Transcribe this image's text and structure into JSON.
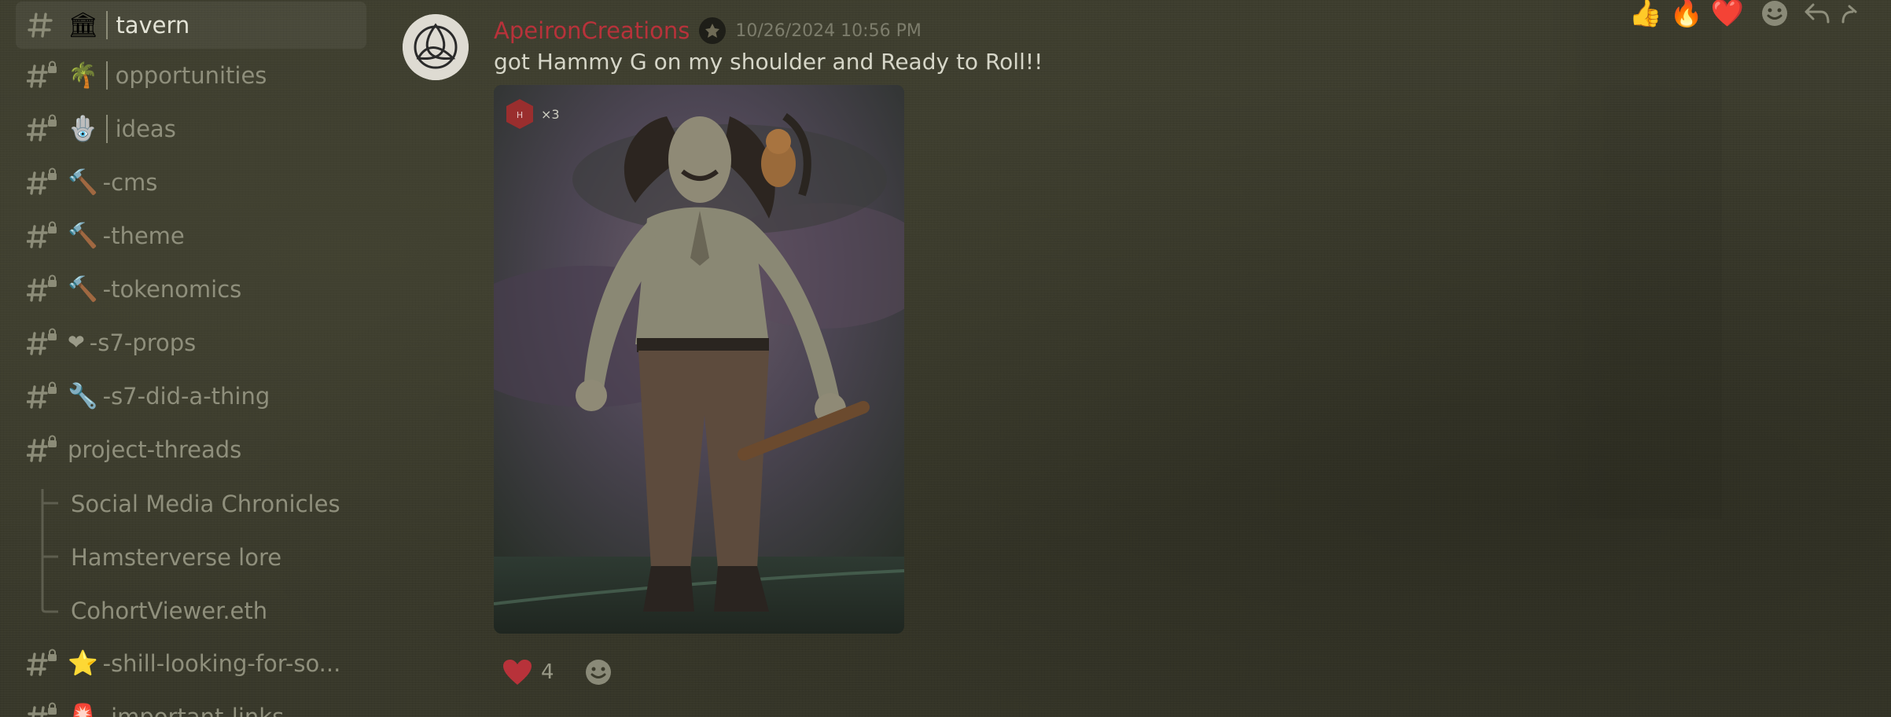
{
  "sidebar": {
    "channels": [
      {
        "emoji": "🏛",
        "separator": true,
        "name": "tavern",
        "active": true,
        "icon": "text-channel-icon"
      },
      {
        "emoji": "🌴",
        "separator": true,
        "name": "opportunities",
        "active": false,
        "icon": "locked-text-channel-icon"
      },
      {
        "emoji": "🪬",
        "separator": true,
        "name": "ideas",
        "active": false,
        "icon": "locked-text-channel-icon"
      },
      {
        "emoji": "🔨",
        "separator": false,
        "name": "-cms",
        "active": false,
        "icon": "locked-text-channel-icon"
      },
      {
        "emoji": "🔨",
        "separator": false,
        "name": "-theme",
        "active": false,
        "icon": "locked-text-channel-icon"
      },
      {
        "emoji": "🔨",
        "separator": false,
        "name": "-tokenomics",
        "active": false,
        "icon": "locked-text-channel-icon"
      },
      {
        "emoji": "❤",
        "separator": false,
        "name": "-s7-props",
        "active": false,
        "icon": "locked-text-channel-icon"
      },
      {
        "emoji": "🔧",
        "separator": false,
        "name": "-s7-did-a-thing",
        "active": false,
        "icon": "locked-text-channel-icon"
      },
      {
        "emoji": "",
        "separator": false,
        "name": "project-threads",
        "active": false,
        "icon": "locked-text-channel-icon"
      }
    ],
    "threads": [
      "Social Media Chronicles",
      "Hamsterverse lore",
      "CohortViewer.eth"
    ],
    "channels_after": [
      {
        "emoji": "⭐",
        "separator": false,
        "name": "-shill-looking-for-so...",
        "active": false,
        "icon": "locked-text-channel-icon"
      },
      {
        "emoji": "🚨",
        "separator": false,
        "name": "-important-links",
        "active": false,
        "icon": "locked-text-channel-icon"
      }
    ]
  },
  "message": {
    "username": "ApeironCreations",
    "timestamp": "10/26/2024 10:56 PM",
    "text": "got Hammy G on my shoulder and Ready to Roll!!",
    "attachment_badge_count": "×3",
    "reactions": [
      {
        "emoji": "heart-icon",
        "count": "4"
      }
    ]
  },
  "toolbar": {
    "quick_reactions": [
      "👍",
      "🔥",
      "❤️"
    ]
  },
  "colors": {
    "background": "#3b3b2c",
    "username": "#b8323a",
    "text": "#d6d6c8",
    "muted": "#8f8f7c"
  }
}
